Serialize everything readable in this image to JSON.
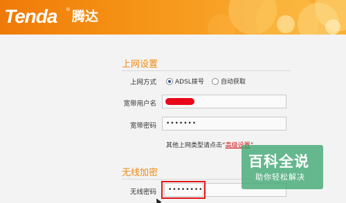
{
  "brand": {
    "logo_text": "Tenda",
    "logo_mark": "®",
    "cn_name": "腾达"
  },
  "internet": {
    "section_title": "上网设置",
    "method_label": "上网方式",
    "options": [
      {
        "label": "ADSL拨号",
        "checked": true
      },
      {
        "label": "自动获取",
        "checked": false
      }
    ],
    "username_label": "宽带用户名",
    "password_label": "宽带密码",
    "password_value": "•••••••",
    "hint_prefix": "其他上网类型请点击“",
    "hint_link": "高级设置",
    "hint_suffix": "”"
  },
  "wireless": {
    "section_title": "无线加密",
    "password_label": "无线密码",
    "password_value": "••••••••"
  },
  "watermark": {
    "main": "百科全说",
    "sub": "助你轻松解决"
  },
  "colors": {
    "accent": "#f08a12",
    "highlight": "#e01414",
    "link": "#d01010"
  }
}
